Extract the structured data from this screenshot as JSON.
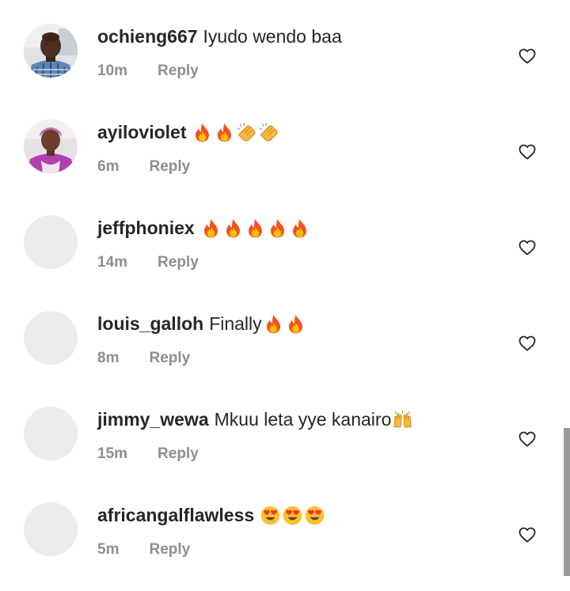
{
  "comments": [
    {
      "username": "ochieng667",
      "text": "Iyudo wendo baa",
      "emojis": [],
      "time": "10m",
      "reply_label": "Reply",
      "avatar": "photo-man-in-plaid-shirt"
    },
    {
      "username": "ayiloviolet",
      "text": "",
      "emojis": [
        "fire",
        "fire",
        "clap",
        "clap"
      ],
      "time": "6m",
      "reply_label": "Reply",
      "avatar": "photo-woman-in-purple"
    },
    {
      "username": "jeffphoniex",
      "text": "",
      "emojis": [
        "fire",
        "fire",
        "fire",
        "fire",
        "fire"
      ],
      "time": "14m",
      "reply_label": "Reply",
      "avatar": "placeholder"
    },
    {
      "username": "louis_galloh",
      "text": "Finally",
      "emojis": [
        "fire",
        "fire"
      ],
      "time": "8m",
      "reply_label": "Reply",
      "avatar": "placeholder"
    },
    {
      "username": "jimmy_wewa",
      "text": "Mkuu leta yye kanairo",
      "emojis": [
        "raising-hands"
      ],
      "time": "15m",
      "reply_label": "Reply",
      "avatar": "placeholder"
    },
    {
      "username": "africangalflawless",
      "text": "",
      "emojis": [
        "heart-eyes",
        "heart-eyes",
        "heart-eyes"
      ],
      "time": "5m",
      "reply_label": "Reply",
      "avatar": "placeholder"
    }
  ],
  "like_icon": "heart-outline-icon",
  "colors": {
    "username": "#262626",
    "meta": "#8e8e8e",
    "placeholder": "#ececec",
    "scrollbar": "#9a9a9a"
  }
}
